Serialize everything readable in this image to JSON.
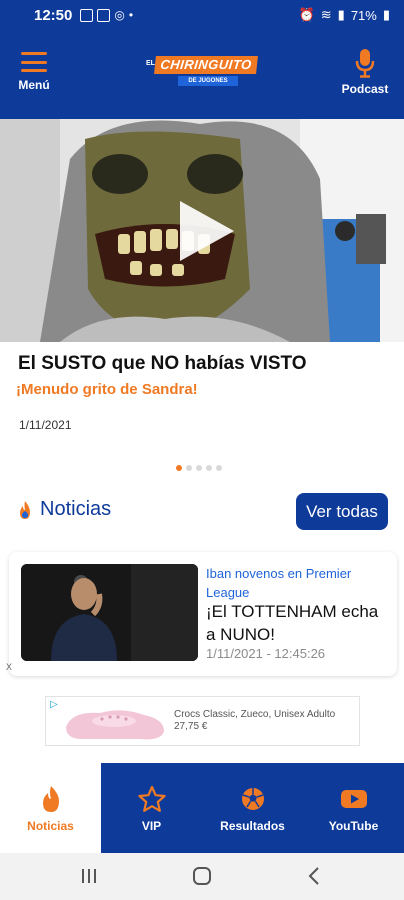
{
  "status_bar": {
    "time": "12:50",
    "battery": "71%"
  },
  "header": {
    "menu_label": "Menú",
    "podcast_label": "Podcast",
    "logo": {
      "prefix": "EL",
      "main": "CHIRINGUITO",
      "sub": "DE JUGONES"
    }
  },
  "featured": {
    "headline": "El SUSTO que NO habías VISTO",
    "subheadline": "¡Menudo grito de Sandra!",
    "date": "1/11/2021",
    "carousel_dots": 5,
    "active_dot": 1
  },
  "news_section": {
    "title": "Noticias",
    "see_all_label": "Ver todas",
    "card": {
      "kicker": "Iban novenos en Premier League",
      "title": "¡El TOTTENHAM echa a NUNO!",
      "date": "1/11/2021 - 12:45:26"
    }
  },
  "ad": {
    "close_label": "X",
    "text_line1": "Crocs Classic, Zueco, Unisex Adulto",
    "text_line2": "27,75 €"
  },
  "bottom_nav": {
    "items": [
      {
        "label": "Noticias",
        "icon": "flame-icon",
        "active": true
      },
      {
        "label": "VIP",
        "icon": "star-icon",
        "active": false
      },
      {
        "label": "Resultados",
        "icon": "soccer-ball-icon",
        "active": false
      },
      {
        "label": "YouTube",
        "icon": "youtube-icon",
        "active": false
      }
    ]
  },
  "colors": {
    "brand_blue": "#0e3a9a",
    "accent_orange": "#f07a24",
    "link_blue": "#1f64d9"
  }
}
